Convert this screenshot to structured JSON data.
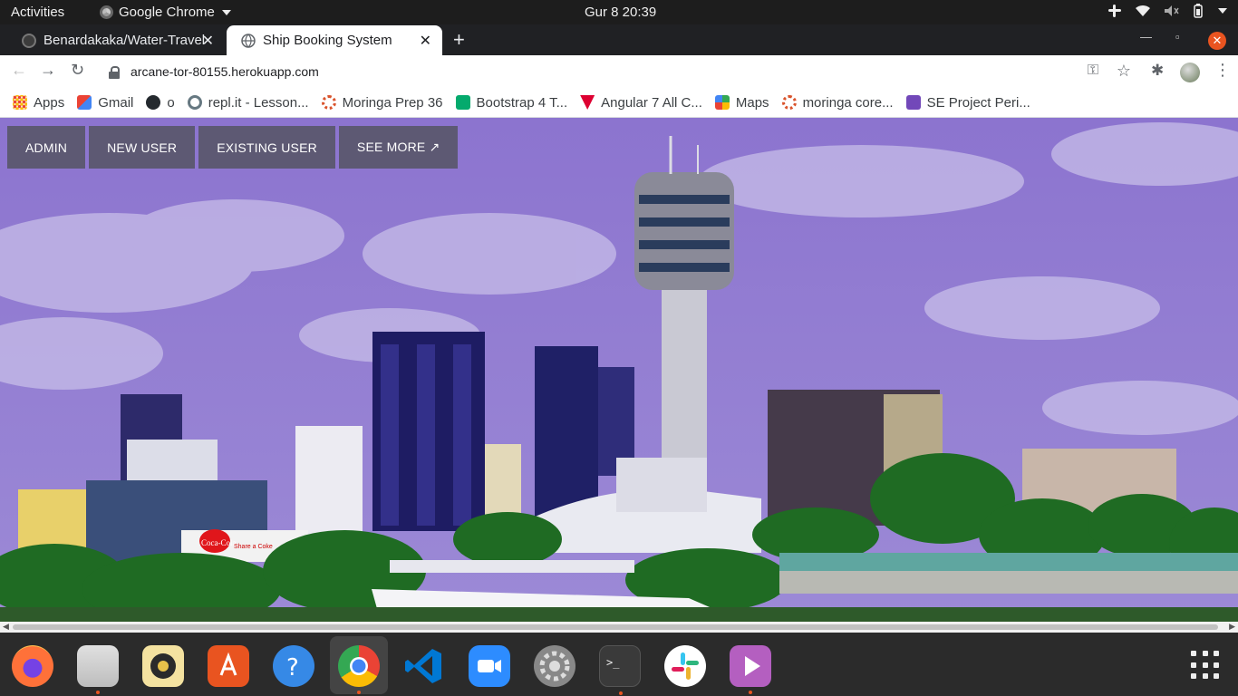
{
  "system_bar": {
    "activities": "Activities",
    "app_name": "Google Chrome",
    "clock": "Gur 8  20:39"
  },
  "tabs": [
    {
      "title": "Benardakaka/Water-Travel",
      "active": false
    },
    {
      "title": "Ship Booking System",
      "active": true
    }
  ],
  "address_bar": {
    "url": "arcane-tor-80155.herokuapp.com"
  },
  "bookmarks": [
    {
      "label": "Apps",
      "icon": "apps-grid-icon",
      "color": "#4285f4"
    },
    {
      "label": "Gmail",
      "icon": "gmail-icon",
      "color": "#ea4335"
    },
    {
      "label": "o",
      "icon": "github-icon",
      "color": "#24292e"
    },
    {
      "label": "repl.it - Lesson...",
      "icon": "replit-icon",
      "color": "#667881"
    },
    {
      "label": "Moringa Prep 36",
      "icon": "moringa-icon",
      "color": "#d9532c"
    },
    {
      "label": "Bootstrap 4 T...",
      "icon": "w3-icon",
      "color": "#04aa6d"
    },
    {
      "label": "Angular 7 All C...",
      "icon": "angular-icon",
      "color": "#dd0031"
    },
    {
      "label": "Maps",
      "icon": "maps-icon",
      "color": "#34a853"
    },
    {
      "label": "moringa core...",
      "icon": "moringa-icon",
      "color": "#d9532c"
    },
    {
      "label": "SE Project Peri...",
      "icon": "forms-icon",
      "color": "#7248b9"
    }
  ],
  "site_nav": {
    "admin": "ADMIN",
    "new_user": "NEW USER",
    "existing_user": "EXISTING USER",
    "see_more": "SEE MORE ↗"
  },
  "billboard": {
    "brand": "Coca-Cola",
    "tagline": "Share a Coke"
  },
  "dock": [
    {
      "name": "firefox",
      "color": "#ff7139",
      "running": false
    },
    {
      "name": "files",
      "color": "#d4d4d4",
      "running": true
    },
    {
      "name": "rhythmbox",
      "color": "#f4e2a0",
      "running": false
    },
    {
      "name": "ubuntu-software",
      "color": "#e95420",
      "running": false
    },
    {
      "name": "help",
      "color": "#3689e6",
      "running": false
    },
    {
      "name": "chrome",
      "color": "#4285f4",
      "running": true
    },
    {
      "name": "vscode",
      "color": "#0078d4",
      "running": false
    },
    {
      "name": "zoom",
      "color": "#2d8cff",
      "running": false
    },
    {
      "name": "settings",
      "color": "#999999",
      "running": false
    },
    {
      "name": "terminal",
      "color": "#3a3a3a",
      "running": true
    },
    {
      "name": "slack",
      "color": "#ffffff",
      "running": false
    },
    {
      "name": "video-player",
      "color": "#b45fc0",
      "running": true
    }
  ]
}
